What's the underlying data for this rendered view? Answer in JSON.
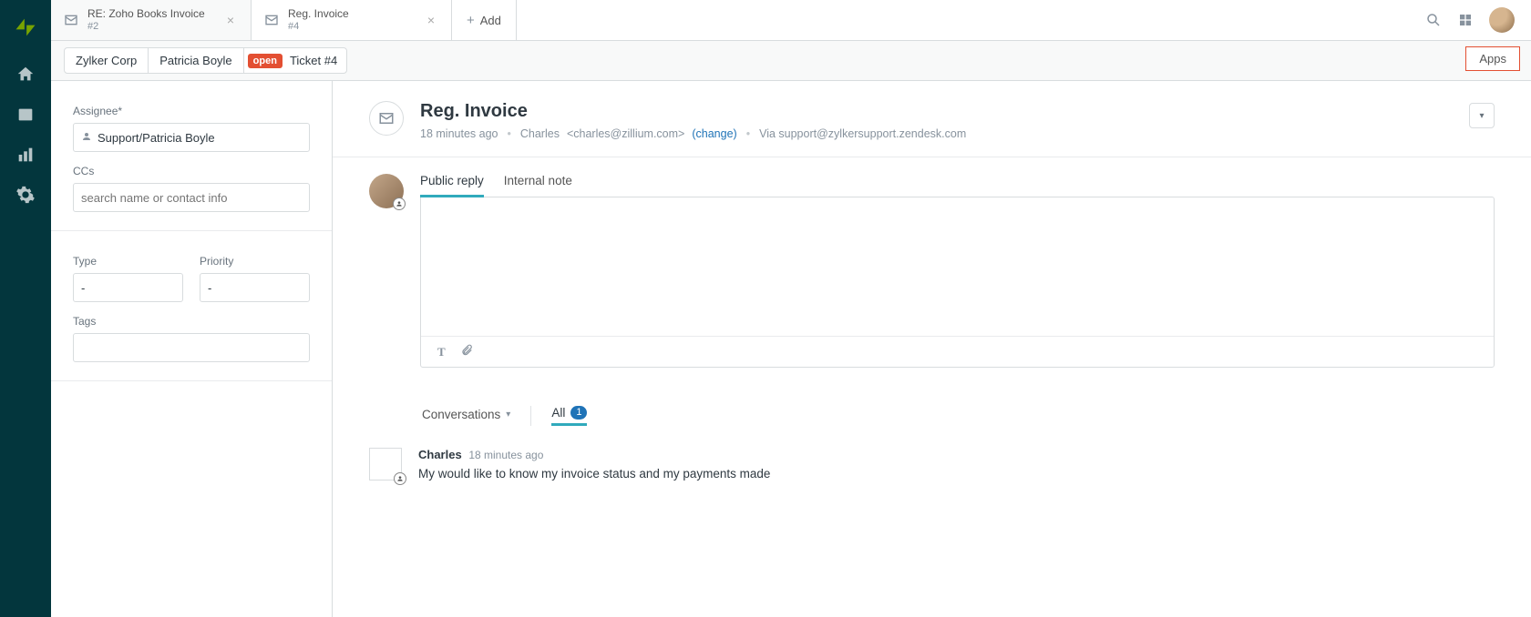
{
  "tabs": [
    {
      "title": "RE: Zoho Books Invoice",
      "sub": "#2"
    },
    {
      "title": "Reg. Invoice",
      "sub": "#4"
    }
  ],
  "add_tab_label": "Add",
  "breadcrumb": {
    "org": "Zylker Corp",
    "requester": "Patricia Boyle",
    "status": "open",
    "ticket": "Ticket #4"
  },
  "apps_button": "Apps",
  "sidepanel": {
    "assignee_label": "Assignee*",
    "assignee_value": "Support/Patricia Boyle",
    "ccs_label": "CCs",
    "ccs_placeholder": "search name or contact info",
    "type_label": "Type",
    "type_value": "-",
    "priority_label": "Priority",
    "priority_value": "-",
    "tags_label": "Tags"
  },
  "ticket": {
    "title": "Reg. Invoice",
    "age": "18 minutes ago",
    "from_name": "Charles",
    "from_email": "<charles@zillium.com>",
    "change": "(change)",
    "via": "Via support@zylkersupport.zendesk.com"
  },
  "reply": {
    "public": "Public reply",
    "internal": "Internal note"
  },
  "conversations": {
    "label": "Conversations",
    "all_label": "All",
    "all_count": "1"
  },
  "message": {
    "author": "Charles",
    "time": "18 minutes ago",
    "text": "My would like to know my invoice status and my payments made"
  }
}
